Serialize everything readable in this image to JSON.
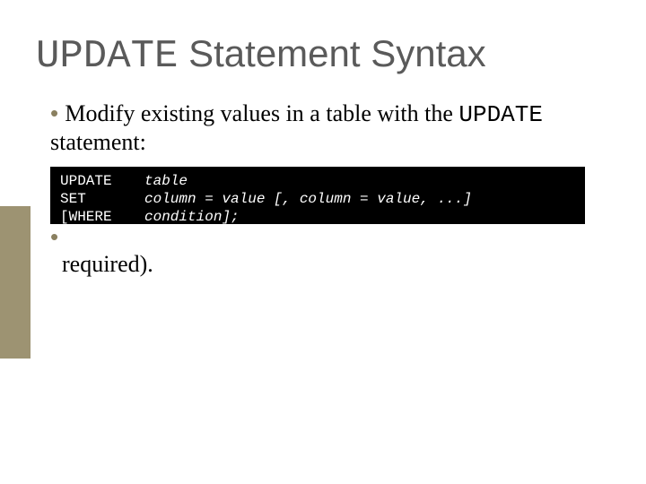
{
  "title": {
    "code": "UPDATE",
    "rest": " Statement Syntax"
  },
  "bullet1": {
    "prefix": "Modify existing values in a table with the ",
    "code": "UPDATE",
    "suffix": " statement:"
  },
  "code": {
    "r1k": "UPDATE",
    "r1a": "table",
    "r2k": "SET",
    "r2a": "column = value [, column = value, ...]",
    "r3k": "[WHERE",
    "r3a": "condition];"
  },
  "bullet2": {
    "text": "required)."
  }
}
